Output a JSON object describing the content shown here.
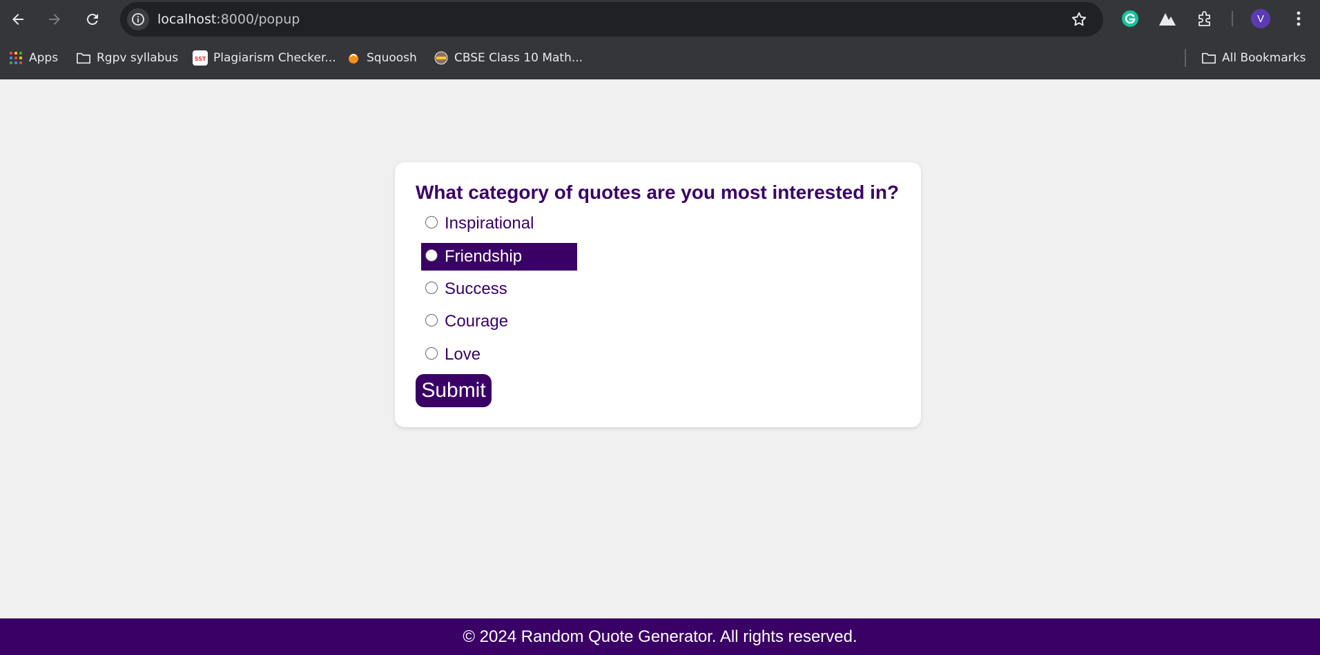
{
  "browser": {
    "url_host": "localhost",
    "url_path": ":8000/popup",
    "profile_initial": "V"
  },
  "bookmarks": {
    "items": [
      {
        "label": "Apps",
        "icon": "apps-grid-icon"
      },
      {
        "label": "Rgpv syllabus",
        "icon": "folder-icon"
      },
      {
        "label": "Plagiarism Checker...",
        "icon": "sst-favicon"
      },
      {
        "label": "Squoosh",
        "icon": "squoosh-favicon"
      },
      {
        "label": "CBSE Class 10 Math...",
        "icon": "cbse-favicon"
      }
    ],
    "all_bookmarks": "All Bookmarks"
  },
  "quiz": {
    "question": "What category of quotes are you most interested in?",
    "options": [
      "Inspirational",
      "Friendship",
      "Success",
      "Courage",
      "Love"
    ],
    "highlighted_option": "Friendship",
    "submit_label": "Submit"
  },
  "footer": {
    "text": "© 2024 Random Quote Generator. All rights reserved."
  },
  "colors": {
    "accent": "#3a0066",
    "page_bg": "#f0f0f0",
    "chrome_bg": "#35363a"
  }
}
